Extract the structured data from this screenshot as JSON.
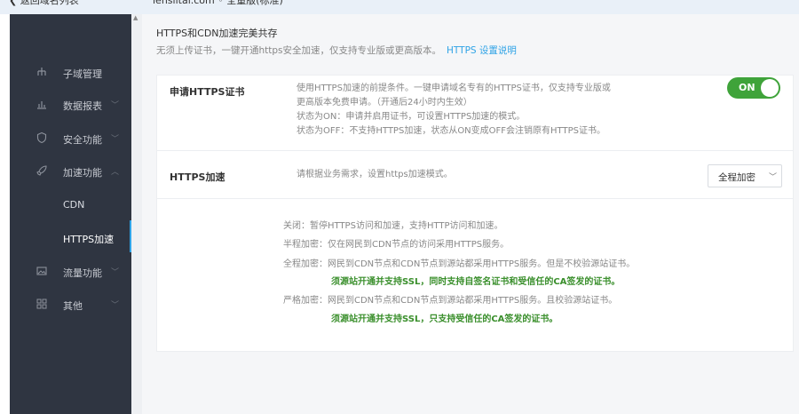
{
  "topbar": {
    "back_label": "❮ 返回域名列表",
    "domain_label": "lensiitai.com  ◦ 全量版(标准)"
  },
  "sidebar": {
    "items": [
      {
        "label": "子域管理",
        "icon": "sitemap-icon"
      },
      {
        "label": "数据报表",
        "icon": "chart-icon"
      },
      {
        "label": "安全功能",
        "icon": "shield-icon"
      },
      {
        "label": "加速功能",
        "icon": "rocket-icon"
      },
      {
        "label": "CDN"
      },
      {
        "label": "HTTPS加速"
      },
      {
        "label": "流量功能",
        "icon": "image-icon"
      },
      {
        "label": "其他",
        "icon": "grid-icon"
      }
    ]
  },
  "header": {
    "title": "HTTPS和CDN加速完美共存",
    "desc": "无须上传证书，一键开通https安全加速，仅支持专业版或更高版本。",
    "link": "HTTPS 设置说明"
  },
  "cert": {
    "title": "申请HTTPS证书",
    "desc1": "使用HTTPS加速的前提条件。一键申请域名专有的HTTPS证书，仅支持专业版或",
    "desc2": "更高版本免费申请。（开通后24小时内生效）",
    "desc3": "状态为ON：申请并启用证书，可设置HTTPS加速的模式。",
    "desc4": "状态为OFF：不支持HTTPS加速，状态从ON变成OFF会注销原有HTTPS证书。",
    "toggle_label": "ON"
  },
  "accel": {
    "title": "HTTPS加速",
    "desc": "请根据业务需求，设置https加速模式。",
    "select_value": "全程加密",
    "modes": {
      "off": "关闭：暂停HTTPS访问和加速，支持HTTP访问和加速。",
      "half": "半程加密：仅在网民到CDN节点的访问采用HTTPS服务。",
      "full": "全程加密：网民到CDN节点和CDN节点到源站都采用HTTPS服务。但是不校验源站证书。",
      "full_note": "须源站开通并支持SSL，同时支持自签名证书和受信任的CA签发的证书。",
      "strict": "严格加密：网民到CDN节点和CDN节点到源站都采用HTTPS服务。且校验源站证书。",
      "strict_note": "须源站开通并支持SSL，只支持受信任的CA签发的证书。"
    }
  },
  "colors": {
    "sidebar_bg": "#2f3541",
    "accent": "#2fa3e6",
    "toggle_on": "#3fa33a",
    "note_green": "#3a8f2c"
  }
}
